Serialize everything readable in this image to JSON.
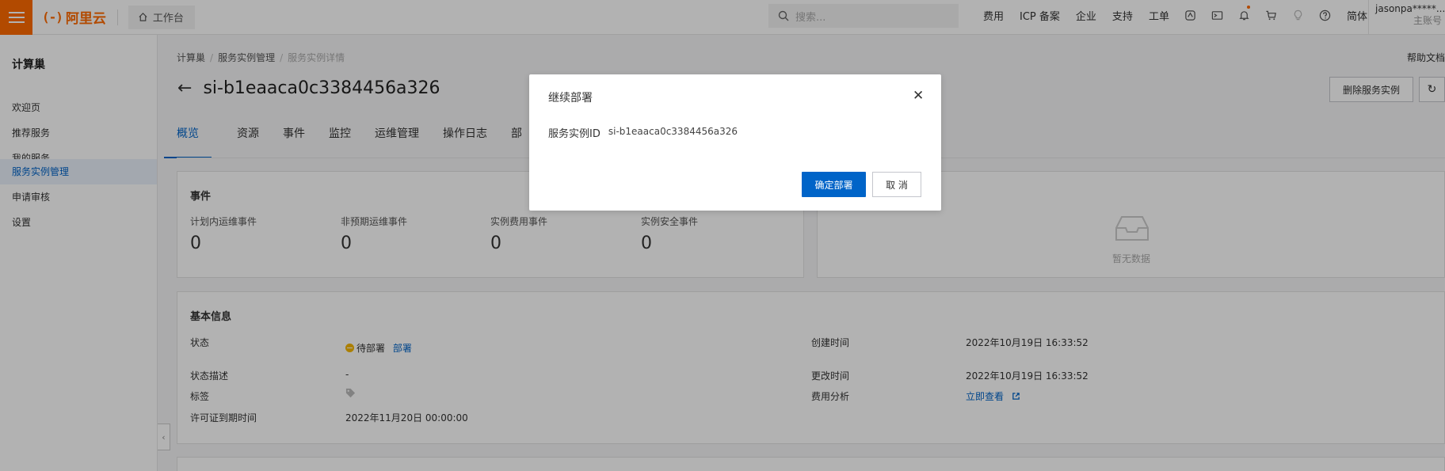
{
  "topbar": {
    "logo_mark": "(-)",
    "logo_text": "阿里云",
    "workbench_label": "工作台",
    "search_placeholder": "搜索...",
    "nav_items": [
      "费用",
      "ICP 备案",
      "企业",
      "支持",
      "工单"
    ],
    "lang": "简体",
    "user_name": "jasonpa*****...",
    "account_type": "主账号"
  },
  "sidebar": {
    "title": "计算巢",
    "items": [
      {
        "label": "欢迎页",
        "active": false
      },
      {
        "label": "推荐服务",
        "active": false
      },
      {
        "label": "我的服务",
        "active": false
      },
      {
        "label": "服务实例管理",
        "active": true
      },
      {
        "label": "申请审核",
        "active": false
      },
      {
        "label": "设置",
        "active": false
      }
    ]
  },
  "breadcrumb": [
    "计算巢",
    "服务实例管理",
    "服务实例详情"
  ],
  "help_link": "帮助文档",
  "page_title": "si-b1eaaca0c3384456a326",
  "buttons": {
    "delete_instance": "删除服务实例"
  },
  "tabs": [
    "概览",
    "资源",
    "事件",
    "监控",
    "运维管理",
    "操作日志",
    "部"
  ],
  "events": {
    "title": "事件",
    "items": [
      {
        "label": "计划内运维事件",
        "value": "0"
      },
      {
        "label": "非预期运维事件",
        "value": "0"
      },
      {
        "label": "实例费用事件",
        "value": "0"
      },
      {
        "label": "实例安全事件",
        "value": "0"
      }
    ]
  },
  "empty_panel": {
    "text": "暂无数据"
  },
  "basic_info": {
    "title": "基本信息",
    "status_label": "状态",
    "status_value": "待部署",
    "status_action": "部署",
    "status_desc_label": "状态描述",
    "status_desc_value": "-",
    "tags_label": "标签",
    "license_label": "许可证到期时间",
    "license_value": "2022年11月20日 00:00:00",
    "created_label": "创建时间",
    "created_value": "2022年10月19日 16:33:52",
    "modified_label": "更改时间",
    "modified_value": "2022年10月19日 16:33:52",
    "cost_label": "费用分析",
    "cost_link": "立即查看"
  },
  "modal": {
    "title": "继续部署",
    "instance_id_label": "服务实例ID",
    "instance_id_value": "si-b1eaaca0c3384456a326",
    "confirm_label": "确定部署",
    "cancel_label": "取 消"
  },
  "colors": {
    "brand": "#ff6a00",
    "primary": "#0064c8",
    "status_pending": "#f5b700"
  }
}
